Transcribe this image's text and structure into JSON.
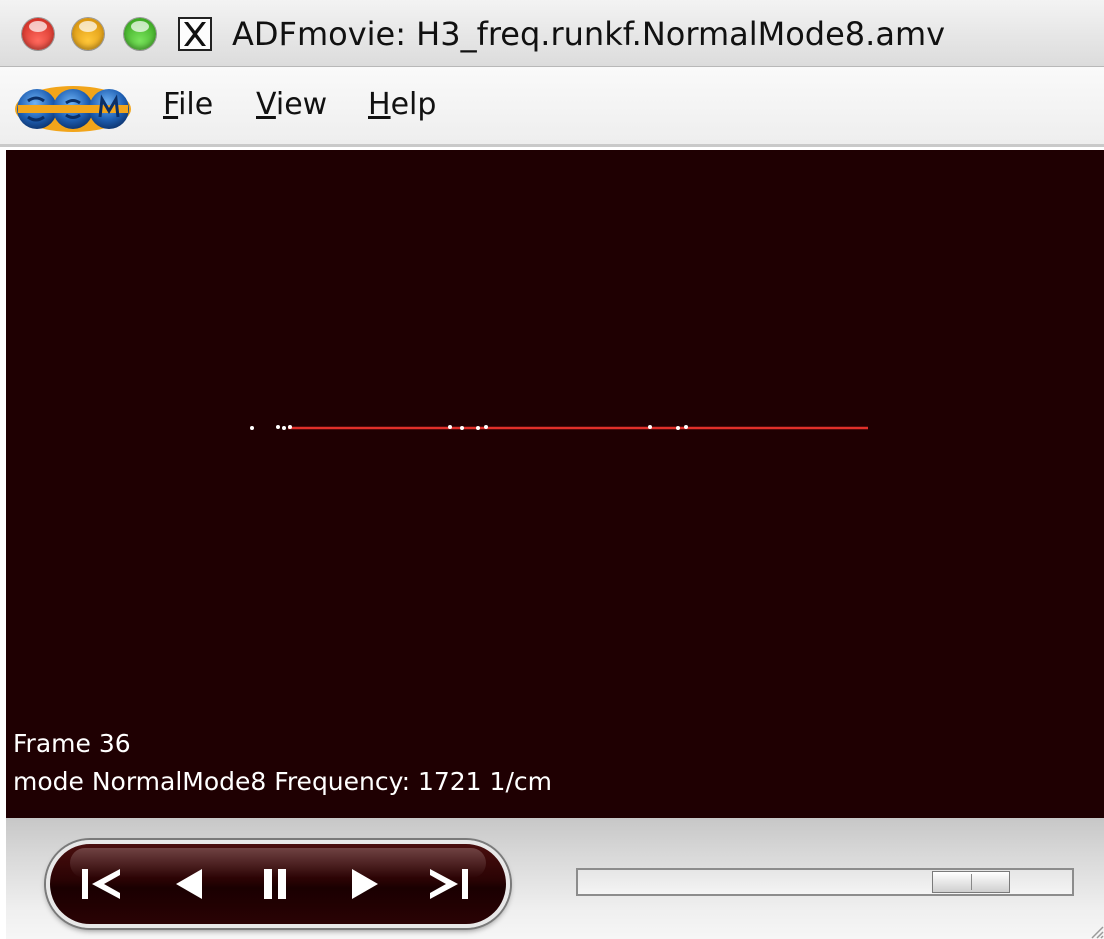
{
  "window": {
    "title": "ADFmovie: H3_freq.runkf.NormalMode8.amv",
    "close_icon": "close-icon",
    "minimize_icon": "minimize-icon",
    "zoom_icon": "zoom-icon",
    "app_icon": "x11-icon"
  },
  "menubar": {
    "logo": "scm-logo",
    "items": [
      {
        "mnemonic": "F",
        "rest": "ile"
      },
      {
        "mnemonic": "V",
        "rest": "iew"
      },
      {
        "mnemonic": "H",
        "rest": "elp"
      }
    ]
  },
  "viewport": {
    "background": "#1f0002",
    "bond_color": "#e0302a",
    "frame_label": "Frame 36",
    "mode_label": "mode NormalMode8 Frequency: 1721 1/cm"
  },
  "controls": {
    "buttons": [
      "first-frame-icon",
      "previous-frame-icon",
      "pause-icon",
      "next-frame-icon",
      "last-frame-icon"
    ],
    "slider_position": 0.85
  }
}
